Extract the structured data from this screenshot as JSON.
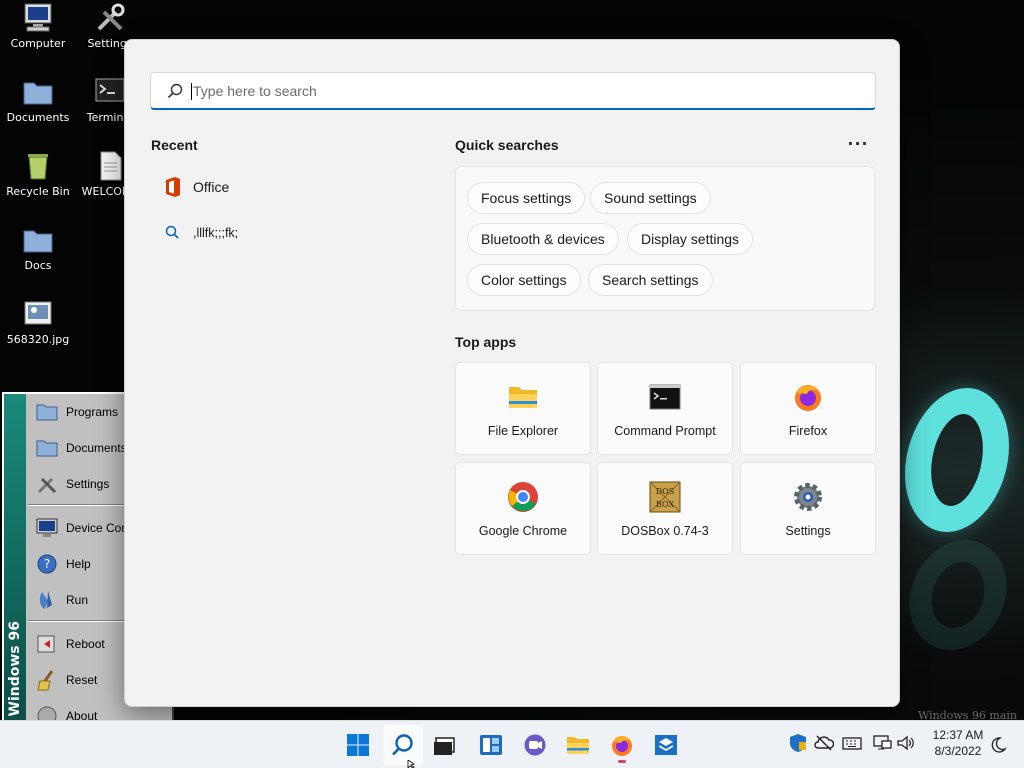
{
  "desktop": {
    "icons": [
      {
        "label": "Computer",
        "icon": "computer-icon"
      },
      {
        "label": "Settings",
        "icon": "tools-icon"
      },
      {
        "label": "Documents",
        "icon": "folder-icon"
      },
      {
        "label": "Terminal",
        "icon": "terminal-icon"
      },
      {
        "label": "Recycle Bin",
        "icon": "recycle-bin-icon"
      },
      {
        "label": "WELCOME",
        "icon": "document-icon"
      },
      {
        "label": "Docs",
        "icon": "folder-icon"
      },
      {
        "label": "568320.jpg",
        "icon": "image-file-icon"
      }
    ],
    "watermark": "Windows 96 main"
  },
  "w96_start_menu": {
    "band_text": "Windows 96",
    "items": [
      {
        "label": "Programs",
        "icon": "folder-icon"
      },
      {
        "label": "Documents",
        "icon": "folder-icon"
      },
      {
        "label": "Settings",
        "icon": "tools-icon"
      },
      {
        "label": "Device Config",
        "icon": "monitor-icon"
      },
      {
        "label": "Help",
        "icon": "help-icon"
      },
      {
        "label": "Run",
        "icon": "run-icon"
      },
      {
        "label": "Reboot",
        "icon": "reboot-icon"
      },
      {
        "label": "Reset",
        "icon": "broom-icon"
      },
      {
        "label": "About",
        "icon": "about-icon"
      }
    ]
  },
  "search": {
    "placeholder": "Type here to search",
    "recent_title": "Recent",
    "recent": [
      {
        "label": "Office",
        "icon": "office-icon"
      },
      {
        "label": ",lllfk;;;fk;",
        "icon": "search-icon"
      }
    ],
    "quick_title": "Quick searches",
    "more_label": "···",
    "quick": [
      "Focus settings",
      "Sound settings",
      "Bluetooth & devices",
      "Display settings",
      "Color settings",
      "Search settings"
    ],
    "top_apps_title": "Top apps",
    "top_apps": [
      {
        "label": "File Explorer",
        "icon": "file-explorer-icon"
      },
      {
        "label": "Command Prompt",
        "icon": "command-prompt-icon"
      },
      {
        "label": "Firefox",
        "icon": "firefox-icon"
      },
      {
        "label": "Google Chrome",
        "icon": "chrome-icon"
      },
      {
        "label": "DOSBox 0.74-3",
        "icon": "dosbox-icon"
      },
      {
        "label": "Settings",
        "icon": "settings-gear-icon"
      }
    ]
  },
  "taskbar": {
    "buttons": [
      "windows-start-icon",
      "search-icon",
      "task-view-icon",
      "widgets-icon",
      "chat-icon",
      "file-explorer-icon",
      "firefox-icon",
      "store-icon"
    ],
    "tray": [
      "security-shield-icon",
      "cloud-offline-icon",
      "keyboard-icon",
      "network-icon",
      "speaker-icon"
    ],
    "time": "12:37 AM",
    "date": "8/3/2022",
    "accent": "#0067c0"
  }
}
